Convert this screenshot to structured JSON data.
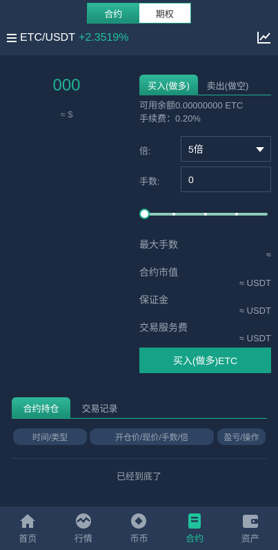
{
  "header": {
    "segment": [
      "合约",
      "期权"
    ],
    "pair": "ETC/USDT",
    "change": "+2.3519%"
  },
  "price": {
    "value": "000",
    "usd": "≈ $"
  },
  "trade_tabs": [
    "买入(做多)",
    "卖出(做空)"
  ],
  "balance": "可用余额0.00000000 ETC",
  "fee": "手续费：0.20%",
  "leverage": {
    "label": "倍:",
    "value": "5倍"
  },
  "quantity": {
    "label": "手数:",
    "value": "0"
  },
  "slider": {
    "fraction": 0
  },
  "stats": [
    {
      "label": "最大手数",
      "value": "≈"
    },
    {
      "label": "合约市值",
      "value": "≈ USDT"
    },
    {
      "label": "保证金",
      "value": "≈ USDT"
    },
    {
      "label": "交易服务费",
      "value": "≈ USDT"
    }
  ],
  "buy_button": "买入(做多)ETC",
  "position_tabs": [
    "合约持仓",
    "交易记录"
  ],
  "table_headers": [
    "时间/类型",
    "开仓价/现价/手数/倍",
    "盈亏/操作"
  ],
  "end_text": "已经到底了",
  "nav": [
    {
      "label": "首页",
      "icon": "home-icon"
    },
    {
      "label": "行情",
      "icon": "market-icon"
    },
    {
      "label": "币币",
      "icon": "coin-icon"
    },
    {
      "label": "合约",
      "icon": "contract-icon",
      "active": true
    },
    {
      "label": "资产",
      "icon": "wallet-icon"
    }
  ],
  "colors": {
    "accent": "#1fb394",
    "background": "#1b2a40",
    "nav": "#283a55"
  }
}
